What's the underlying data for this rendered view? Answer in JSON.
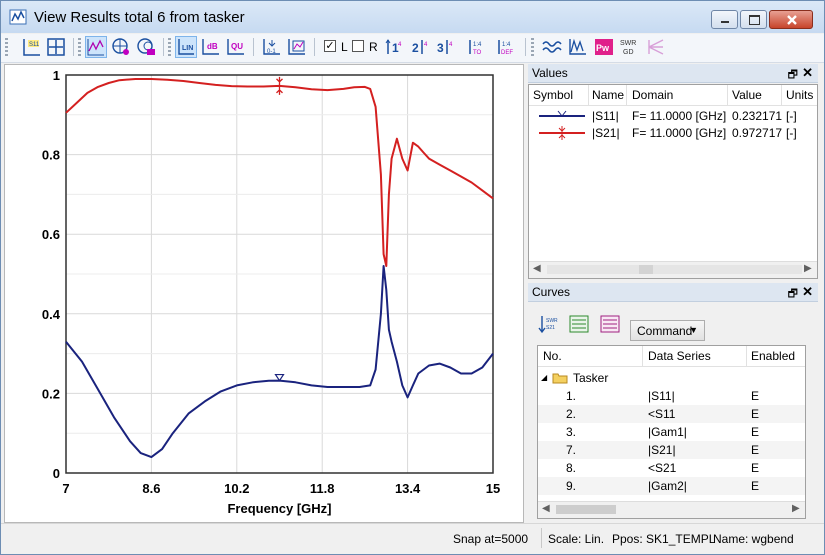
{
  "window": {
    "title": "View Results total 6 from tasker",
    "minimize_icon": "minimize-icon",
    "maximize_icon": "maximize-icon",
    "close_icon": "close-icon"
  },
  "toolbar": {
    "icons": [
      "s11-axis-icon",
      "marker-cross-icon",
      "curve-wave-icon",
      "polar-icon",
      "smith-icon",
      "linear-scale-icon",
      "db-scale-icon",
      "qu-scale-icon",
      "zoom-icon",
      "zoom-fit-icon",
      "marker-1-icon",
      "marker-2-icon",
      "marker-3-icon",
      "marker-ito-icon",
      "marker-def-icon",
      "waveform-icon",
      "spectrum-icon",
      "power-icon",
      "swr-gd-icon",
      "fan-icon"
    ],
    "l_label": "L",
    "r_label": "R",
    "l_checked": true,
    "r_checked": false
  },
  "chart_data": {
    "type": "line",
    "xlabel": "Frequency [GHz]",
    "ylabel": "",
    "xlim": [
      7,
      15
    ],
    "ylim": [
      0,
      1
    ],
    "x_ticks": [
      "7",
      "8.6",
      "10.2",
      "11.8",
      "13.4",
      "15"
    ],
    "y_ticks": [
      "0",
      "0.2",
      "0.4",
      "0.6",
      "0.8",
      "1"
    ],
    "grid": true,
    "series": [
      {
        "name": "|S21|",
        "color": "#d42020",
        "x": [
          7.0,
          7.2,
          7.4,
          7.6,
          7.8,
          8.0,
          8.3,
          8.6,
          8.9,
          9.2,
          9.5,
          9.8,
          10.1,
          10.4,
          10.7,
          11.0,
          11.3,
          11.6,
          11.9,
          12.2,
          12.4,
          12.6,
          12.7,
          12.8,
          12.9,
          12.95,
          13.0,
          13.05,
          13.1,
          13.2,
          13.3,
          13.4,
          13.5,
          13.6,
          13.7,
          13.8,
          14.0,
          14.2,
          14.4,
          14.6,
          14.8,
          15.0
        ],
        "y": [
          0.905,
          0.93,
          0.955,
          0.97,
          0.98,
          0.987,
          0.99,
          0.99,
          0.988,
          0.985,
          0.98,
          0.975,
          0.972,
          0.971,
          0.971,
          0.9727,
          0.969,
          0.964,
          0.962,
          0.965,
          0.969,
          0.97,
          0.965,
          0.92,
          0.75,
          0.55,
          0.52,
          0.7,
          0.79,
          0.84,
          0.79,
          0.76,
          0.83,
          0.82,
          0.805,
          0.79,
          0.775,
          0.76,
          0.745,
          0.73,
          0.71,
          0.69
        ]
      },
      {
        "name": "|S11|",
        "color": "#1a237e",
        "x": [
          7.0,
          7.3,
          7.6,
          7.9,
          8.2,
          8.4,
          8.6,
          8.8,
          9.0,
          9.3,
          9.6,
          9.9,
          10.2,
          10.5,
          10.8,
          11.0,
          11.3,
          11.6,
          11.9,
          12.2,
          12.5,
          12.7,
          12.8,
          12.9,
          12.95,
          13.0,
          13.05,
          13.1,
          13.2,
          13.3,
          13.4,
          13.5,
          13.6,
          13.8,
          14.0,
          14.2,
          14.4,
          14.6,
          14.8,
          15.0
        ],
        "y": [
          0.33,
          0.28,
          0.21,
          0.14,
          0.08,
          0.05,
          0.04,
          0.06,
          0.1,
          0.15,
          0.18,
          0.205,
          0.22,
          0.228,
          0.232,
          0.2322,
          0.228,
          0.22,
          0.216,
          0.216,
          0.216,
          0.22,
          0.26,
          0.4,
          0.52,
          0.46,
          0.36,
          0.33,
          0.28,
          0.22,
          0.19,
          0.22,
          0.25,
          0.27,
          0.275,
          0.265,
          0.25,
          0.25,
          0.265,
          0.3
        ]
      }
    ],
    "markers": [
      {
        "series": "|S21|",
        "x": 11.0,
        "y": 0.9727
      },
      {
        "series": "|S11|",
        "x": 11.0,
        "y": 0.2322
      }
    ]
  },
  "values_panel": {
    "title": "Values",
    "headers": [
      "Symbol",
      "Name",
      "Domain",
      "Value",
      "Units"
    ],
    "rows": [
      {
        "name": "|S11|",
        "domain": "F= 11.0000 [GHz]",
        "value": "0.232171",
        "units": "[-]",
        "color": "#1a237e"
      },
      {
        "name": "|S21|",
        "domain": "F= 11.0000 [GHz]",
        "value": "0.972717",
        "units": "[-]",
        "color": "#d42020"
      }
    ]
  },
  "curves_panel": {
    "title": "Curves",
    "command_label": "Command",
    "headers": [
      "No.",
      "Data Series",
      "Enabled"
    ],
    "group_label": "Tasker",
    "rows": [
      {
        "no": "1.",
        "series": "|S11|",
        "enabled": "E"
      },
      {
        "no": "2.",
        "series": "<S11",
        "enabled": "E"
      },
      {
        "no": "3.",
        "series": "|Gam1|",
        "enabled": "E"
      },
      {
        "no": "7.",
        "series": "|S21|",
        "enabled": "E"
      },
      {
        "no": "8.",
        "series": "<S21",
        "enabled": "E"
      },
      {
        "no": "9.",
        "series": "|Gam2|",
        "enabled": "E"
      }
    ]
  },
  "status": {
    "snap": "Snap at=5000",
    "scale": "Scale: Lin.",
    "ppos": "Ppos: SK1_TEMPL",
    "name": "Name: wgbend"
  }
}
